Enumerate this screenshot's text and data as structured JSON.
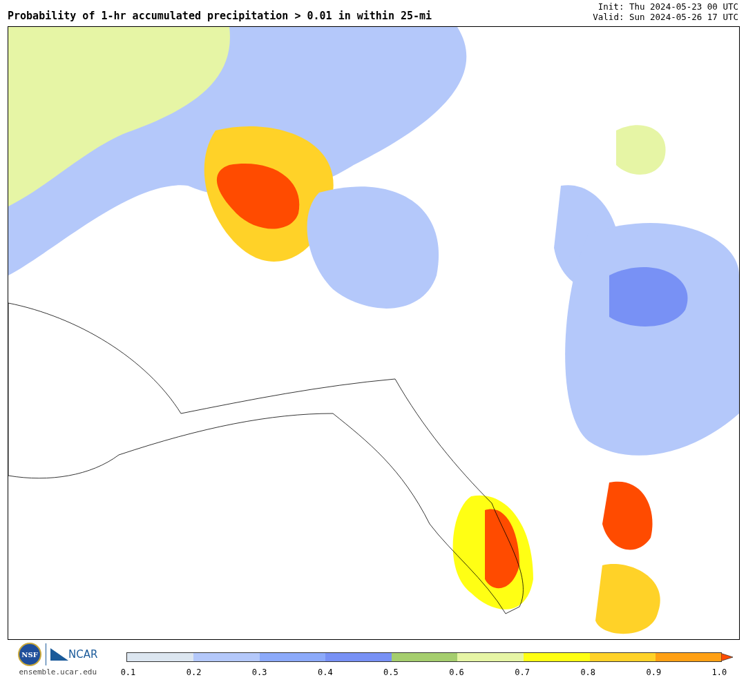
{
  "title": "Probability of 1-hr accumulated precipitation > 0.01 in within 25-mi",
  "init": "Init: Thu 2024-05-23 00 UTC",
  "valid": "Valid: Sun 2024-05-26 17 UTC",
  "logos": {
    "nsf": "NSF",
    "ncar": "NCAR",
    "site": "ensemble.ucar.edu"
  },
  "legend": {
    "bins": [
      {
        "kind": "bin",
        "color": "#dce6f0"
      },
      {
        "kind": "bin",
        "color": "#b4c8fa"
      },
      {
        "kind": "bin",
        "color": "#8caafa"
      },
      {
        "kind": "bin",
        "color": "#7891f5"
      },
      {
        "kind": "bin",
        "color": "#a5ce6e"
      },
      {
        "kind": "bin",
        "color": "#e6f5a5"
      },
      {
        "kind": "bin",
        "color": "#ffff14"
      },
      {
        "kind": "bin",
        "color": "#ffd228"
      },
      {
        "kind": "bin",
        "color": "#ffa014"
      },
      {
        "kind": "extend",
        "color": "#ff4b00"
      }
    ],
    "ticks": [
      "0.1",
      "0.2",
      "0.3",
      "0.4",
      "0.5",
      "0.6",
      "0.7",
      "0.8",
      "0.9",
      "1.0"
    ]
  }
}
